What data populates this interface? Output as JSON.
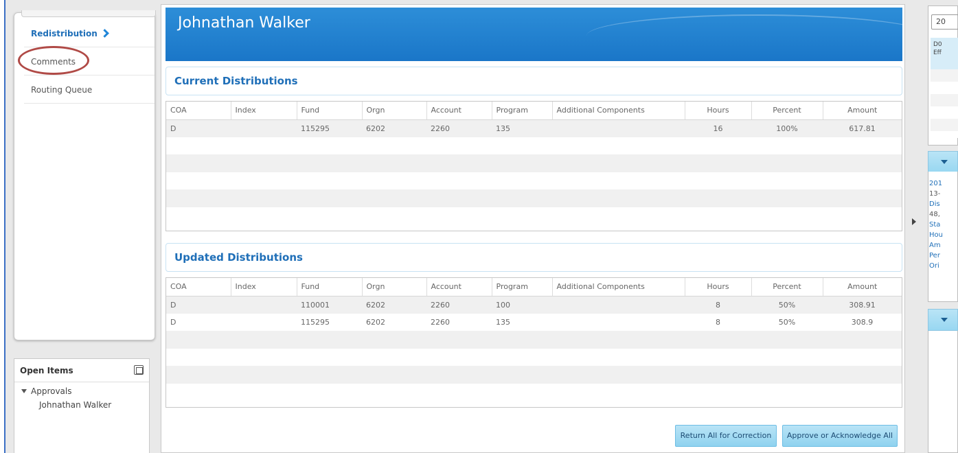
{
  "nav": {
    "items": [
      {
        "label": "Redistribution",
        "active": true
      },
      {
        "label": "Comments",
        "active": false,
        "highlighted": true
      },
      {
        "label": "Routing Queue",
        "active": false
      }
    ]
  },
  "open_items": {
    "title": "Open Items",
    "group": "Approvals",
    "entries": [
      "Johnathan Walker"
    ]
  },
  "header": {
    "title": "Johnathan Walker"
  },
  "columns": [
    "COA",
    "Index",
    "Fund",
    "Orgn",
    "Account",
    "Program",
    "Additional Components",
    "Hours",
    "Percent",
    "Amount"
  ],
  "current": {
    "title": "Current Distributions",
    "rows": [
      {
        "coa": "D",
        "index": "",
        "fund": "115295",
        "orgn": "6202",
        "account": "2260",
        "program": "135",
        "additional": "",
        "hours": "16",
        "percent": "100%",
        "amount": "617.81"
      }
    ]
  },
  "updated": {
    "title": "Updated Distributions",
    "rows": [
      {
        "coa": "D",
        "index": "",
        "fund": "110001",
        "orgn": "6202",
        "account": "2260",
        "program": "100",
        "additional": "",
        "hours": "8",
        "percent": "50%",
        "amount": "308.91"
      },
      {
        "coa": "D",
        "index": "",
        "fund": "115295",
        "orgn": "6202",
        "account": "2260",
        "program": "135",
        "additional": "",
        "hours": "8",
        "percent": "50%",
        "amount": "308.9"
      }
    ]
  },
  "actions": {
    "return_label": "Return All for Correction",
    "approve_label": "Approve or Acknowledge All"
  },
  "right_panel": {
    "input_value": "20",
    "info_line1": "D0",
    "info_line2": "Eff",
    "lines": [
      {
        "text": "201",
        "kind": "link"
      },
      {
        "text": "13-",
        "kind": "val"
      },
      {
        "text": "Dis",
        "kind": "link"
      },
      {
        "text": "48,",
        "kind": "val"
      },
      {
        "text": "Sta",
        "kind": "link"
      },
      {
        "text": "Hou",
        "kind": "link"
      },
      {
        "text": "Am",
        "kind": "link"
      },
      {
        "text": "Per",
        "kind": "link"
      },
      {
        "text": "Ori",
        "kind": "link"
      }
    ]
  },
  "colors": {
    "accent": "#1f6fb8",
    "banner": "#1a76c8",
    "button": "#a6dcf3",
    "highlight_ring": "#b04a46"
  }
}
